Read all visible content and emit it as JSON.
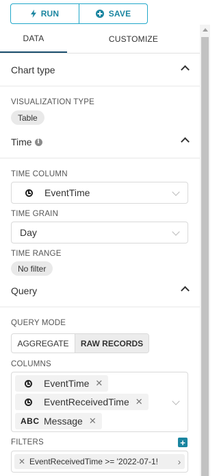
{
  "toolbar": {
    "run_label": "RUN",
    "save_label": "SAVE",
    "accent": "#1a85a0"
  },
  "tabs": [
    {
      "label": "DATA"
    },
    {
      "label": "CUSTOMIZE"
    }
  ],
  "sections": {
    "chart_type": {
      "title": "Chart type",
      "visualization_label": "VISUALIZATION TYPE",
      "visualization_value": "Table"
    },
    "time": {
      "title": "Time",
      "time_column_label": "TIME COLUMN",
      "time_column_value": "EventTime",
      "time_grain_label": "TIME GRAIN",
      "time_grain_value": "Day",
      "time_range_label": "TIME RANGE",
      "time_range_value": "No filter"
    },
    "query": {
      "title": "Query",
      "query_mode_label": "QUERY MODE",
      "modes": [
        "AGGREGATE",
        "RAW RECORDS"
      ],
      "selected_mode": "RAW RECORDS",
      "columns_label": "COLUMNS",
      "columns": [
        {
          "name": "EventTime",
          "icon": "clock-icon"
        },
        {
          "name": "EventReceivedTime",
          "icon": "clock-icon"
        },
        {
          "type": "ABC",
          "name": "Message",
          "icon": "abc-icon"
        }
      ],
      "filters_label": "FILTERS",
      "filters": [
        {
          "text": "EventReceivedTime >= '2022-07-1!"
        }
      ]
    }
  }
}
